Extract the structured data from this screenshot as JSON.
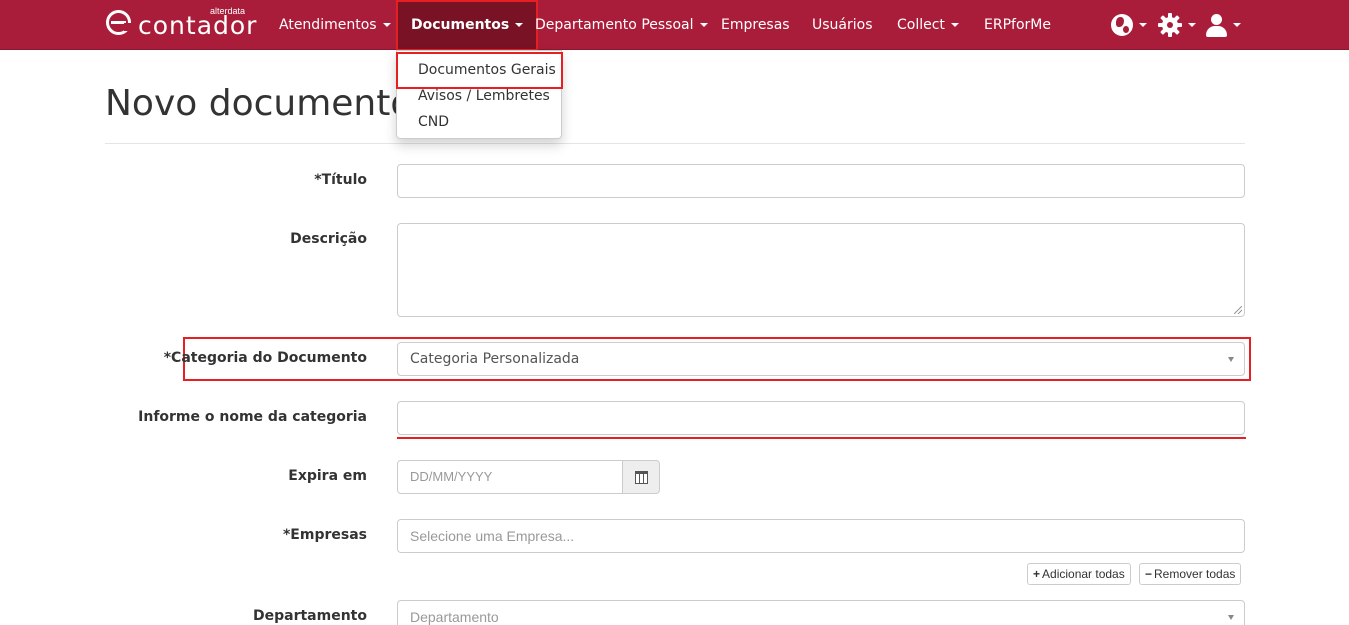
{
  "navbar": {
    "brand": {
      "name": "contador",
      "sub": "alterdata"
    },
    "items": [
      {
        "label": "Atendimentos",
        "dropdown": true
      },
      {
        "label": "Documentos",
        "dropdown": true,
        "active": true
      },
      {
        "label": "Departamento Pessoal",
        "dropdown": true
      },
      {
        "label": "Empresas",
        "dropdown": false
      },
      {
        "label": "Usuários",
        "dropdown": false
      },
      {
        "label": "Collect",
        "dropdown": true
      },
      {
        "label": "ERPforMe",
        "dropdown": false
      }
    ],
    "icons": [
      "globe-icon",
      "gear-icon",
      "user-icon"
    ],
    "color": "#a91d3a"
  },
  "dropdown": {
    "items": [
      "Documentos Gerais",
      "Avisos / Lembretes",
      "CND"
    ],
    "highlighted": "Documentos Gerais"
  },
  "page": {
    "title": "Novo documento"
  },
  "form": {
    "titulo": {
      "label": "*Título",
      "value": ""
    },
    "descricao": {
      "label": "Descrição",
      "value": ""
    },
    "categoria": {
      "label": "*Categoria do Documento",
      "value": "Categoria Personalizada"
    },
    "nome_categoria": {
      "label": "Informe o nome da categoria",
      "value": ""
    },
    "expira": {
      "label": "Expira em",
      "placeholder": "DD/MM/YYYY"
    },
    "empresas": {
      "label": "*Empresas",
      "placeholder": "Selecione uma Empresa...",
      "add_all": "Adicionar todas",
      "remove_all": "Remover todas"
    },
    "departamento": {
      "label": "Departamento",
      "placeholder": "Departamento"
    }
  },
  "highlight_color": "#e62020"
}
